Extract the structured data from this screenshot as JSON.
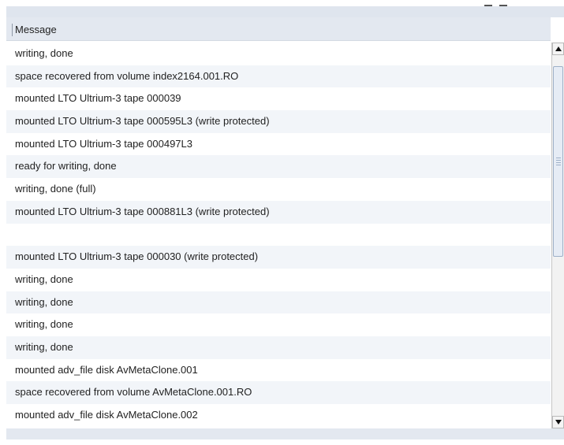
{
  "table": {
    "column_header": "Message",
    "rows": [
      "writing, done",
      "space recovered from volume index2164.001.RO",
      "mounted LTO Ultrium-3 tape 000039",
      "mounted LTO Ultrium-3 tape 000595L3 (write protected)",
      "mounted LTO Ultrium-3 tape 000497L3",
      "ready for writing, done",
      "writing, done (full)",
      "mounted LTO Ultrium-3 tape 000881L3 (write protected)",
      "",
      "mounted LTO Ultrium-3 tape 000030 (write protected)",
      "writing, done",
      "writing, done",
      "writing, done",
      "writing, done",
      "mounted adv_file disk AvMetaClone.001",
      "space recovered from volume AvMetaClone.001.RO",
      "mounted adv_file disk AvMetaClone.002"
    ]
  },
  "scrollbar": {
    "up_icon": "arrow-up-icon",
    "down_icon": "arrow-down-icon"
  }
}
